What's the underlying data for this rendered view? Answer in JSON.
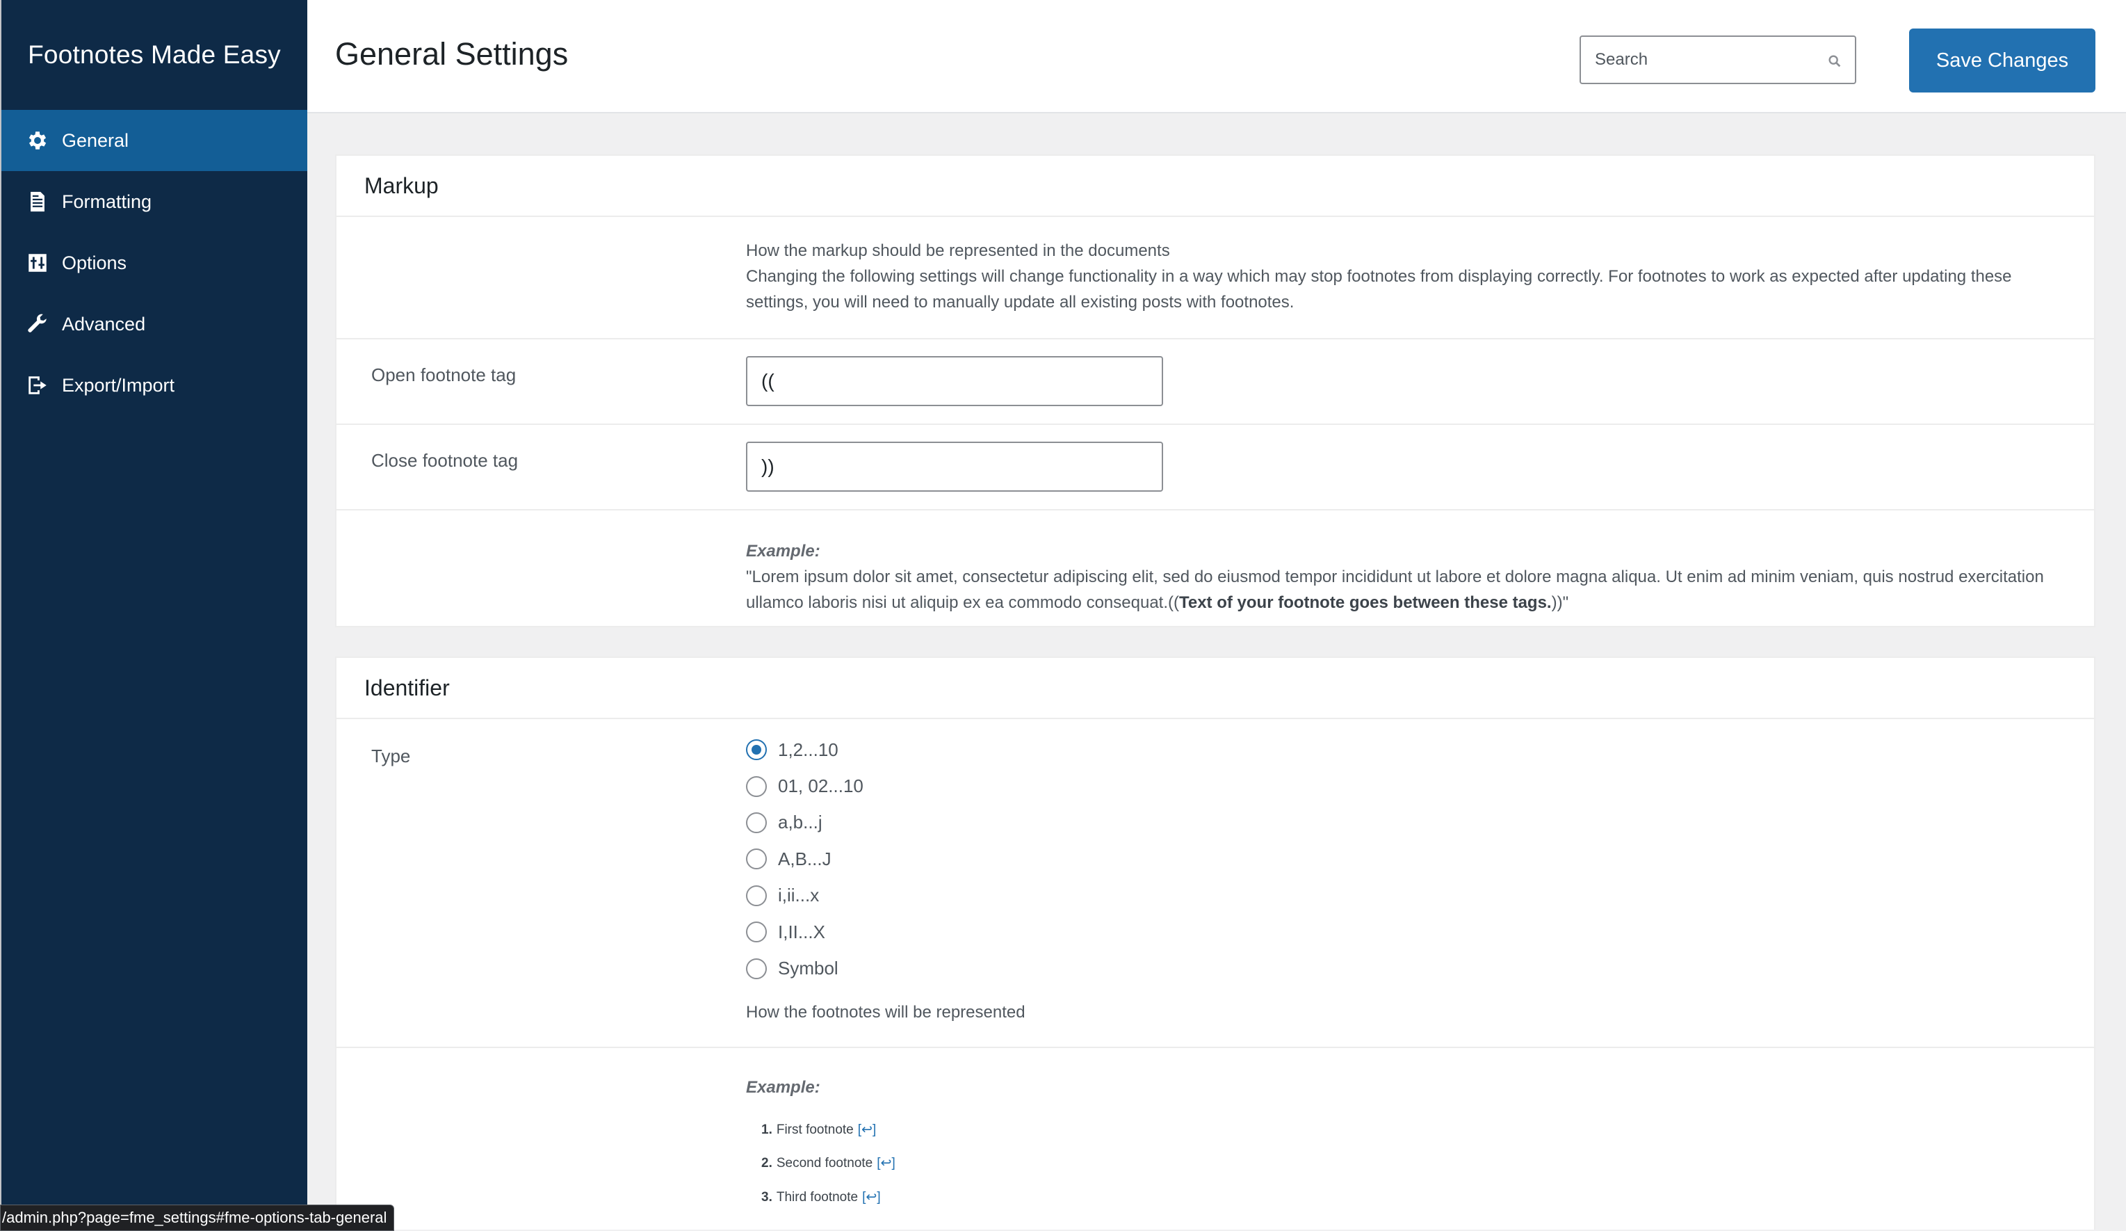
{
  "sidebar": {
    "brand": "Footnotes Made Easy",
    "items": [
      {
        "label": "General",
        "icon": "gear-icon",
        "active": true
      },
      {
        "label": "Formatting",
        "icon": "document-icon",
        "active": false
      },
      {
        "label": "Options",
        "icon": "sliders-icon",
        "active": false
      },
      {
        "label": "Advanced",
        "icon": "wrench-icon",
        "active": false
      },
      {
        "label": "Export/Import",
        "icon": "export-icon",
        "active": false
      }
    ]
  },
  "header": {
    "title": "General Settings",
    "search_placeholder": "Search",
    "save_label": "Save Changes"
  },
  "markup": {
    "title": "Markup",
    "description_line1": "How the markup should be represented in the documents",
    "description_line2": "Changing the following settings will change functionality in a way which may stop footnotes from displaying correctly. For footnotes to work as expected after updating these settings, you will need to manually update all existing posts with footnotes.",
    "open_label": "Open footnote tag",
    "open_value": "((",
    "close_label": "Close footnote tag",
    "close_value": "))",
    "example_label": "Example:",
    "example_text": "\"Lorem ipsum dolor sit amet, consectetur adipiscing elit, sed do eiusmod tempor incididunt ut labore et dolore magna aliqua. Ut enim ad minim veniam, quis nostrud exercitation ullamco laboris nisi ut aliquip ex ea commodo consequat.((",
    "example_strong": "Text of your footnote goes between these tags.",
    "example_end": "))\""
  },
  "identifier": {
    "title": "Identifier",
    "type_label": "Type",
    "options": [
      "1,2...10",
      "01, 02...10",
      "a,b...j",
      "A,B...J",
      "i,ii...x",
      "I,II...X",
      "Symbol"
    ],
    "selected": "1,2...10",
    "help": "How the footnotes will be represented",
    "example_label": "Example:",
    "footnotes": [
      {
        "num": "1.",
        "text": "First footnote"
      },
      {
        "num": "2.",
        "text": "Second footnote"
      },
      {
        "num": "3.",
        "text": "Third footnote"
      }
    ],
    "backlink_glyph": "↩"
  },
  "status_url": "/admin.php?page=fme_settings#fme-options-tab-general"
}
